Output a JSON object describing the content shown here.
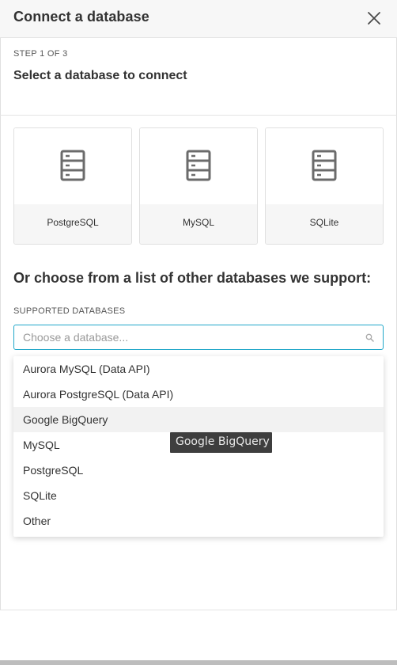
{
  "modal": {
    "title": "Connect a database",
    "step_label": "STEP 1 OF 3",
    "step_title": "Select a database to connect"
  },
  "cards": [
    {
      "label": "PostgreSQL",
      "icon": "database-server-icon"
    },
    {
      "label": "MySQL",
      "icon": "database-server-icon"
    },
    {
      "label": "SQLite",
      "icon": "database-server-icon"
    }
  ],
  "other": {
    "heading": "Or choose from a list of other databases we support:",
    "supported_label": "SUPPORTED DATABASES",
    "placeholder": "Choose a database..."
  },
  "dropdown": {
    "items": [
      "Aurora MySQL (Data API)",
      "Aurora PostgreSQL (Data API)",
      "Google BigQuery",
      "MySQL",
      "PostgreSQL",
      "SQLite",
      "Other"
    ],
    "hovered": "Google BigQuery"
  },
  "tooltip": "Google BigQuery",
  "colors": {
    "accent": "#20a7c9",
    "text": "#323232",
    "tooltip_bg": "#3e3e3e"
  }
}
